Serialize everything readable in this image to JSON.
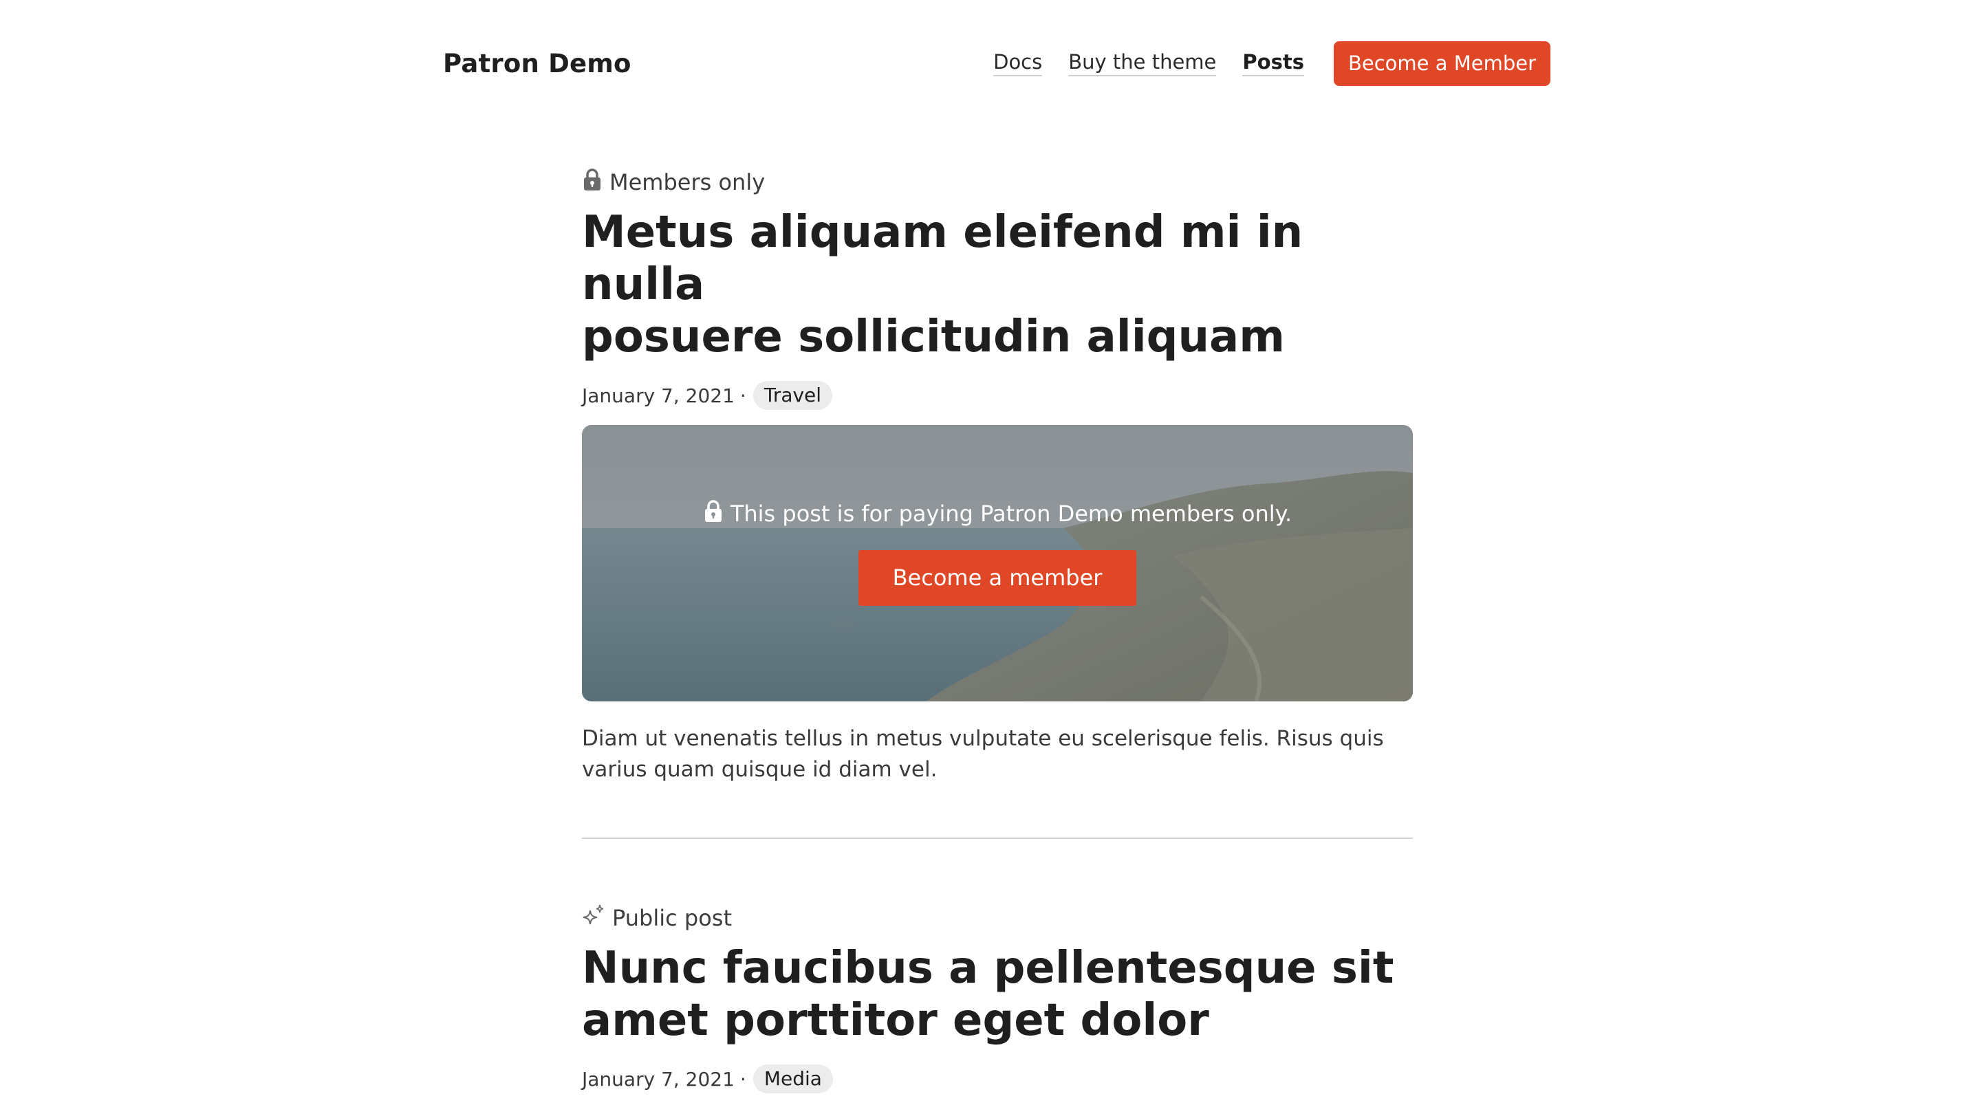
{
  "header": {
    "site_title": "Patron Demo",
    "nav": [
      {
        "label": "Docs",
        "active": false
      },
      {
        "label": "Buy the theme",
        "active": false
      },
      {
        "label": "Posts",
        "active": true
      }
    ],
    "cta_label": "Become a Member",
    "accent_color": "#e04726"
  },
  "posts": [
    {
      "access_label": "Members only",
      "access_icon": "lock-icon",
      "title_line1": "Metus aliquam eleifend mi in nulla",
      "title_line2": "posuere sollicitudin aliquam",
      "date": "January 7, 2021",
      "separator": "·",
      "tag": "Travel",
      "paywall": {
        "message": "This post is for paying Patron Demo members only.",
        "button_label": "Become a member"
      },
      "excerpt_line1": "Diam ut venenatis tellus in metus vulputate eu scelerisque felis. Risus quis",
      "excerpt_line2": "varius quam quisque id diam vel."
    },
    {
      "access_label": "Public post",
      "access_icon": "sparkle-icon",
      "title_line1": "Nunc faucibus a pellentesque sit",
      "title_line2": "amet porttitor eget dolor",
      "date": "January 7, 2021",
      "separator": "·",
      "tag": "Media"
    }
  ]
}
